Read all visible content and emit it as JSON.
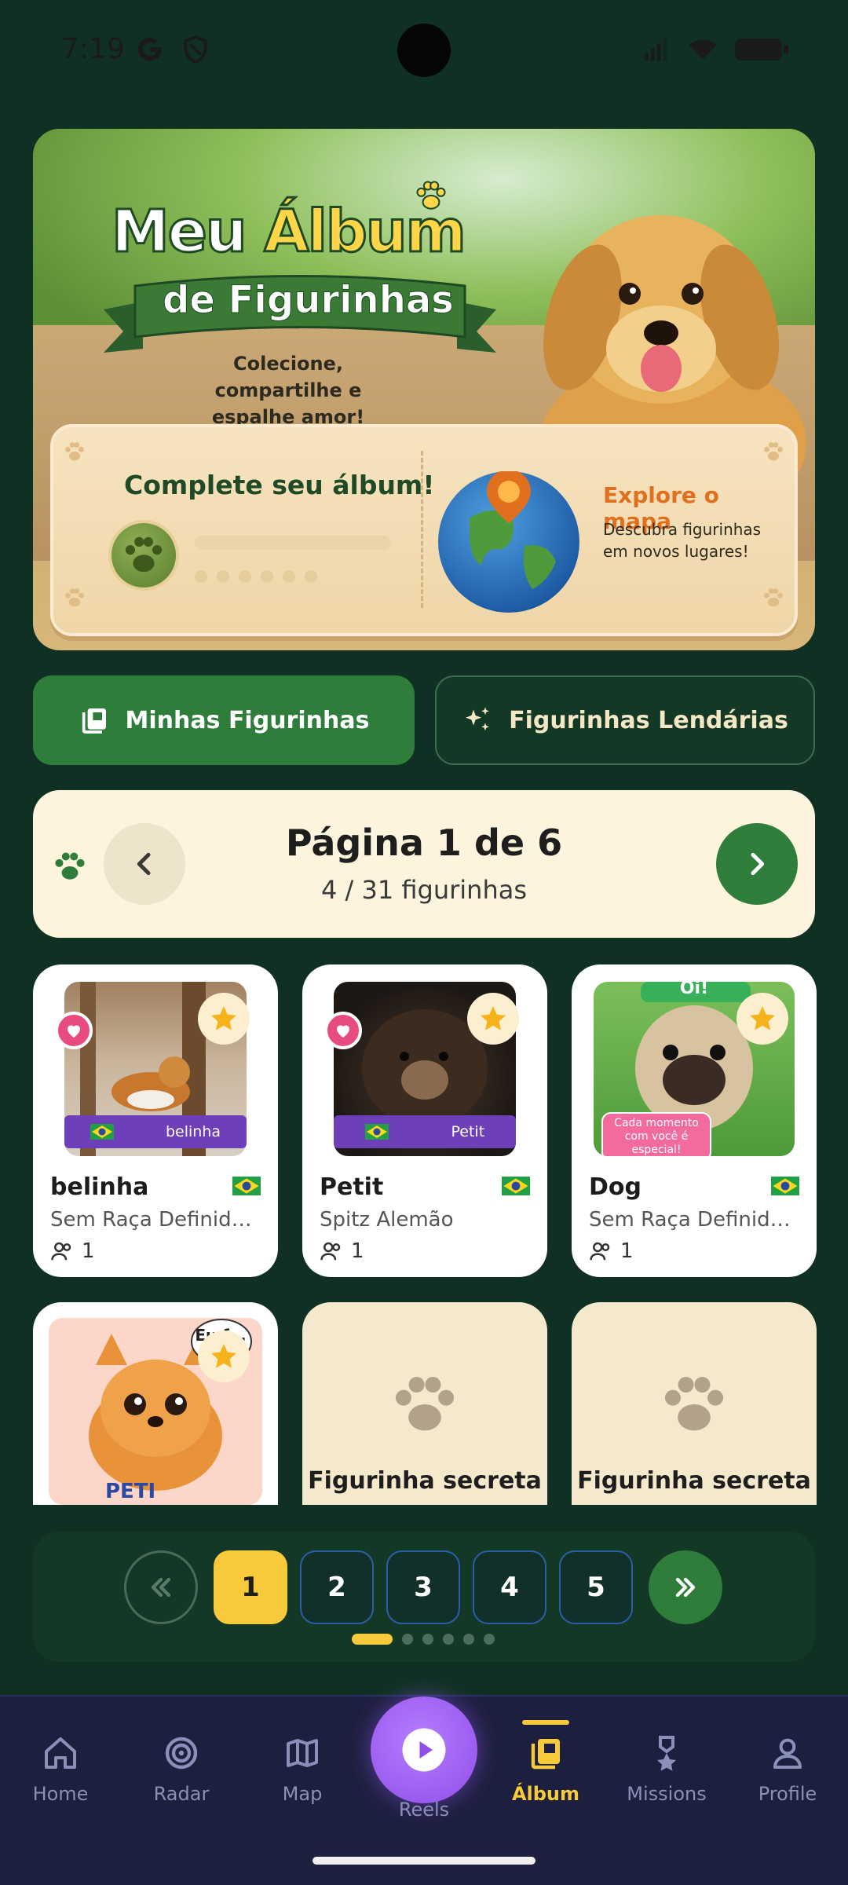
{
  "status_bar": {
    "time": "7:19"
  },
  "hero": {
    "title_word1": "Meu",
    "title_word2": "Álbum",
    "title_ribbon": "de Figurinhas",
    "subtitle": "Colecione, compartilhe e espalhe amor!",
    "complete_title": "Complete seu álbum!",
    "explore_title": "Explore o mapa",
    "explore_subtitle": "Descubra figurinhas em novos lugares!"
  },
  "tabs": {
    "mine": "Minhas Figurinhas",
    "legendary": "Figurinhas Lendárias"
  },
  "page_header": {
    "title": "Página 1 de 6",
    "count": "4 / 31 figurinhas"
  },
  "cards": [
    {
      "name": "belinha",
      "breed": "Sem Raça Definida (...",
      "likes": "1",
      "tag": "belinha"
    },
    {
      "name": "Petit",
      "breed": "Spitz Alemão",
      "likes": "1",
      "tag": "Petit"
    },
    {
      "name": "Dog",
      "breed": "Sem Raça Definida (...",
      "likes": "1",
      "bubble_top": "Oi!",
      "bubble_text": "Cada momento com você é especial!"
    },
    {
      "sticker_text": "PETI",
      "bubble": "Eu f..."
    }
  ],
  "secret_cards": [
    {
      "label": "Figurinha secreta"
    },
    {
      "label": "Figurinha secreta"
    }
  ],
  "pager": {
    "pages": [
      "1",
      "2",
      "3",
      "4",
      "5"
    ],
    "active_page": "1"
  },
  "bottom_nav": {
    "home": "Home",
    "radar": "Radar",
    "map": "Map",
    "reels": "Reels",
    "album": "Álbum",
    "missions": "Missions",
    "profile": "Profile"
  },
  "colors": {
    "background": "#0f3022",
    "accent_green": "#2f7d3a",
    "accent_yellow": "#f8c93a",
    "nav_bg": "#1c1f3e"
  }
}
